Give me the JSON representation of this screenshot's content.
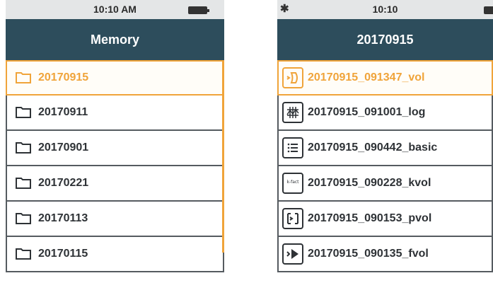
{
  "left": {
    "status_time": "10:10 AM",
    "title": "Memory",
    "items": [
      {
        "label": "20170915",
        "icon": "folder-icon",
        "selected": true
      },
      {
        "label": "20170911",
        "icon": "folder-icon"
      },
      {
        "label": "20170901",
        "icon": "folder-icon"
      },
      {
        "label": "20170221",
        "icon": "folder-icon"
      },
      {
        "label": "20170113",
        "icon": "folder-icon"
      },
      {
        "label": "20170115",
        "icon": "folder-icon"
      }
    ]
  },
  "right": {
    "status_time": "10:10",
    "bluetooth_icon": "bluetooth-icon",
    "title": "20170915",
    "items": [
      {
        "label": "20170915_091347_vol",
        "icon": "vol-icon",
        "selected": true
      },
      {
        "label": "20170915_091001_log",
        "icon": "log-icon"
      },
      {
        "label": "20170915_090442_basic",
        "icon": "basic-icon"
      },
      {
        "label": "20170915_090228_kvol",
        "icon": "kvol-icon",
        "icon_text": "k-fact"
      },
      {
        "label": "20170915_090153_pvol",
        "icon": "pvol-icon"
      },
      {
        "label": "20170915_090135_fvol",
        "icon": "fvol-icon"
      }
    ]
  },
  "colors": {
    "header_bg": "#2d4d5c",
    "accent": "#f0a43a",
    "statusbar_bg": "#e4e6e7",
    "text": "#2e3236"
  }
}
